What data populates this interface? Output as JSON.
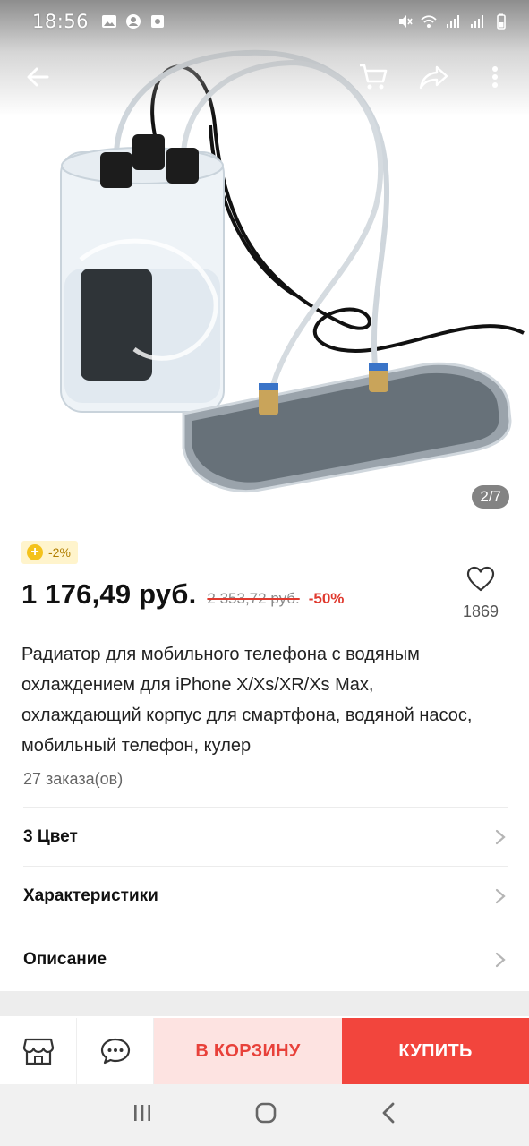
{
  "status_bar": {
    "time": "18:56",
    "left_icons": [
      "gallery-icon",
      "account-icon",
      "camera-icon"
    ],
    "right_icons": [
      "mute-icon",
      "wifi-icon",
      "signal-icon",
      "signal-icon",
      "battery-icon"
    ]
  },
  "top_nav": {
    "back_icon": "back-arrow-icon",
    "cart_icon": "cart-icon",
    "share_icon": "share-icon",
    "menu_icon": "more-vert-icon"
  },
  "gallery": {
    "counter": "2/7"
  },
  "price": {
    "discount_chip": "-2%",
    "current": "1 176,49 руб.",
    "original": "2 353,72 руб.",
    "discount_pct": "-50%",
    "wishlist_count": "1869"
  },
  "product": {
    "title": "Радиатор для мобильного телефона с водяным охлаждением для iPhone X/Xs/XR/Xs Max, охлаждающий корпус для смартфона, водяной насос, мобильный телефон, кулер",
    "orders": "27 заказа(ов)"
  },
  "options": [
    {
      "label": "3 Цвет"
    },
    {
      "label": "Характеристики"
    },
    {
      "label": "Описание"
    }
  ],
  "action_bar": {
    "store_icon": "store-icon",
    "chat_icon": "chat-icon",
    "add_to_cart": "В КОРЗИНУ",
    "buy": "КУПИТЬ"
  },
  "colors": {
    "accent_red": "#f2453d",
    "cart_bg": "#fde3e1",
    "chip_bg": "#fff4cc"
  }
}
